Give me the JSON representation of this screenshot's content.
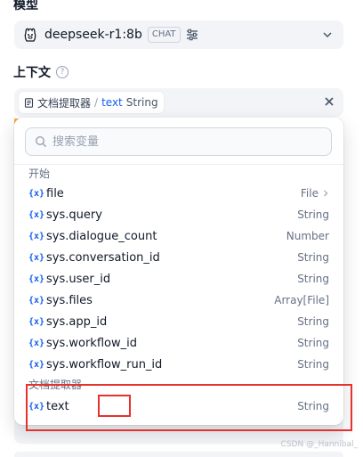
{
  "model_section": {
    "title": "模型",
    "model_name": "deepseek-r1:8b",
    "mode_badge": "CHAT"
  },
  "context_section": {
    "title": "上下文",
    "help_icon": "?",
    "selected_variable": {
      "node_name": "文档提取器",
      "separator": "/",
      "variable_name": "text",
      "type": "String"
    }
  },
  "dropdown": {
    "search_placeholder": "搜索变量",
    "groups": [
      {
        "title": "开始",
        "items": [
          {
            "icon": "{x}",
            "name": "file",
            "type": "File",
            "has_children": true
          },
          {
            "icon": "{x}",
            "name": "sys.query",
            "type": "String"
          },
          {
            "icon": "{x}",
            "name": "sys.dialogue_count",
            "type": "Number"
          },
          {
            "icon": "{x}",
            "name": "sys.conversation_id",
            "type": "String"
          },
          {
            "icon": "{x}",
            "name": "sys.user_id",
            "type": "String"
          },
          {
            "icon": "{x}",
            "name": "sys.files",
            "type": "Array[File]"
          },
          {
            "icon": "{x}",
            "name": "sys.app_id",
            "type": "String"
          },
          {
            "icon": "{x}",
            "name": "sys.workflow_id",
            "type": "String"
          },
          {
            "icon": "{x}",
            "name": "sys.workflow_run_id",
            "type": "String"
          }
        ]
      },
      {
        "title": "文档提取器",
        "items": [
          {
            "icon": "{x}",
            "name": "text",
            "type": "String"
          }
        ]
      }
    ]
  },
  "watermark": "CSDN @_Hannibal_",
  "colors": {
    "accent": "#155eef",
    "highlight_red": "#e5322d",
    "field_bg": "#f2f4f7"
  }
}
